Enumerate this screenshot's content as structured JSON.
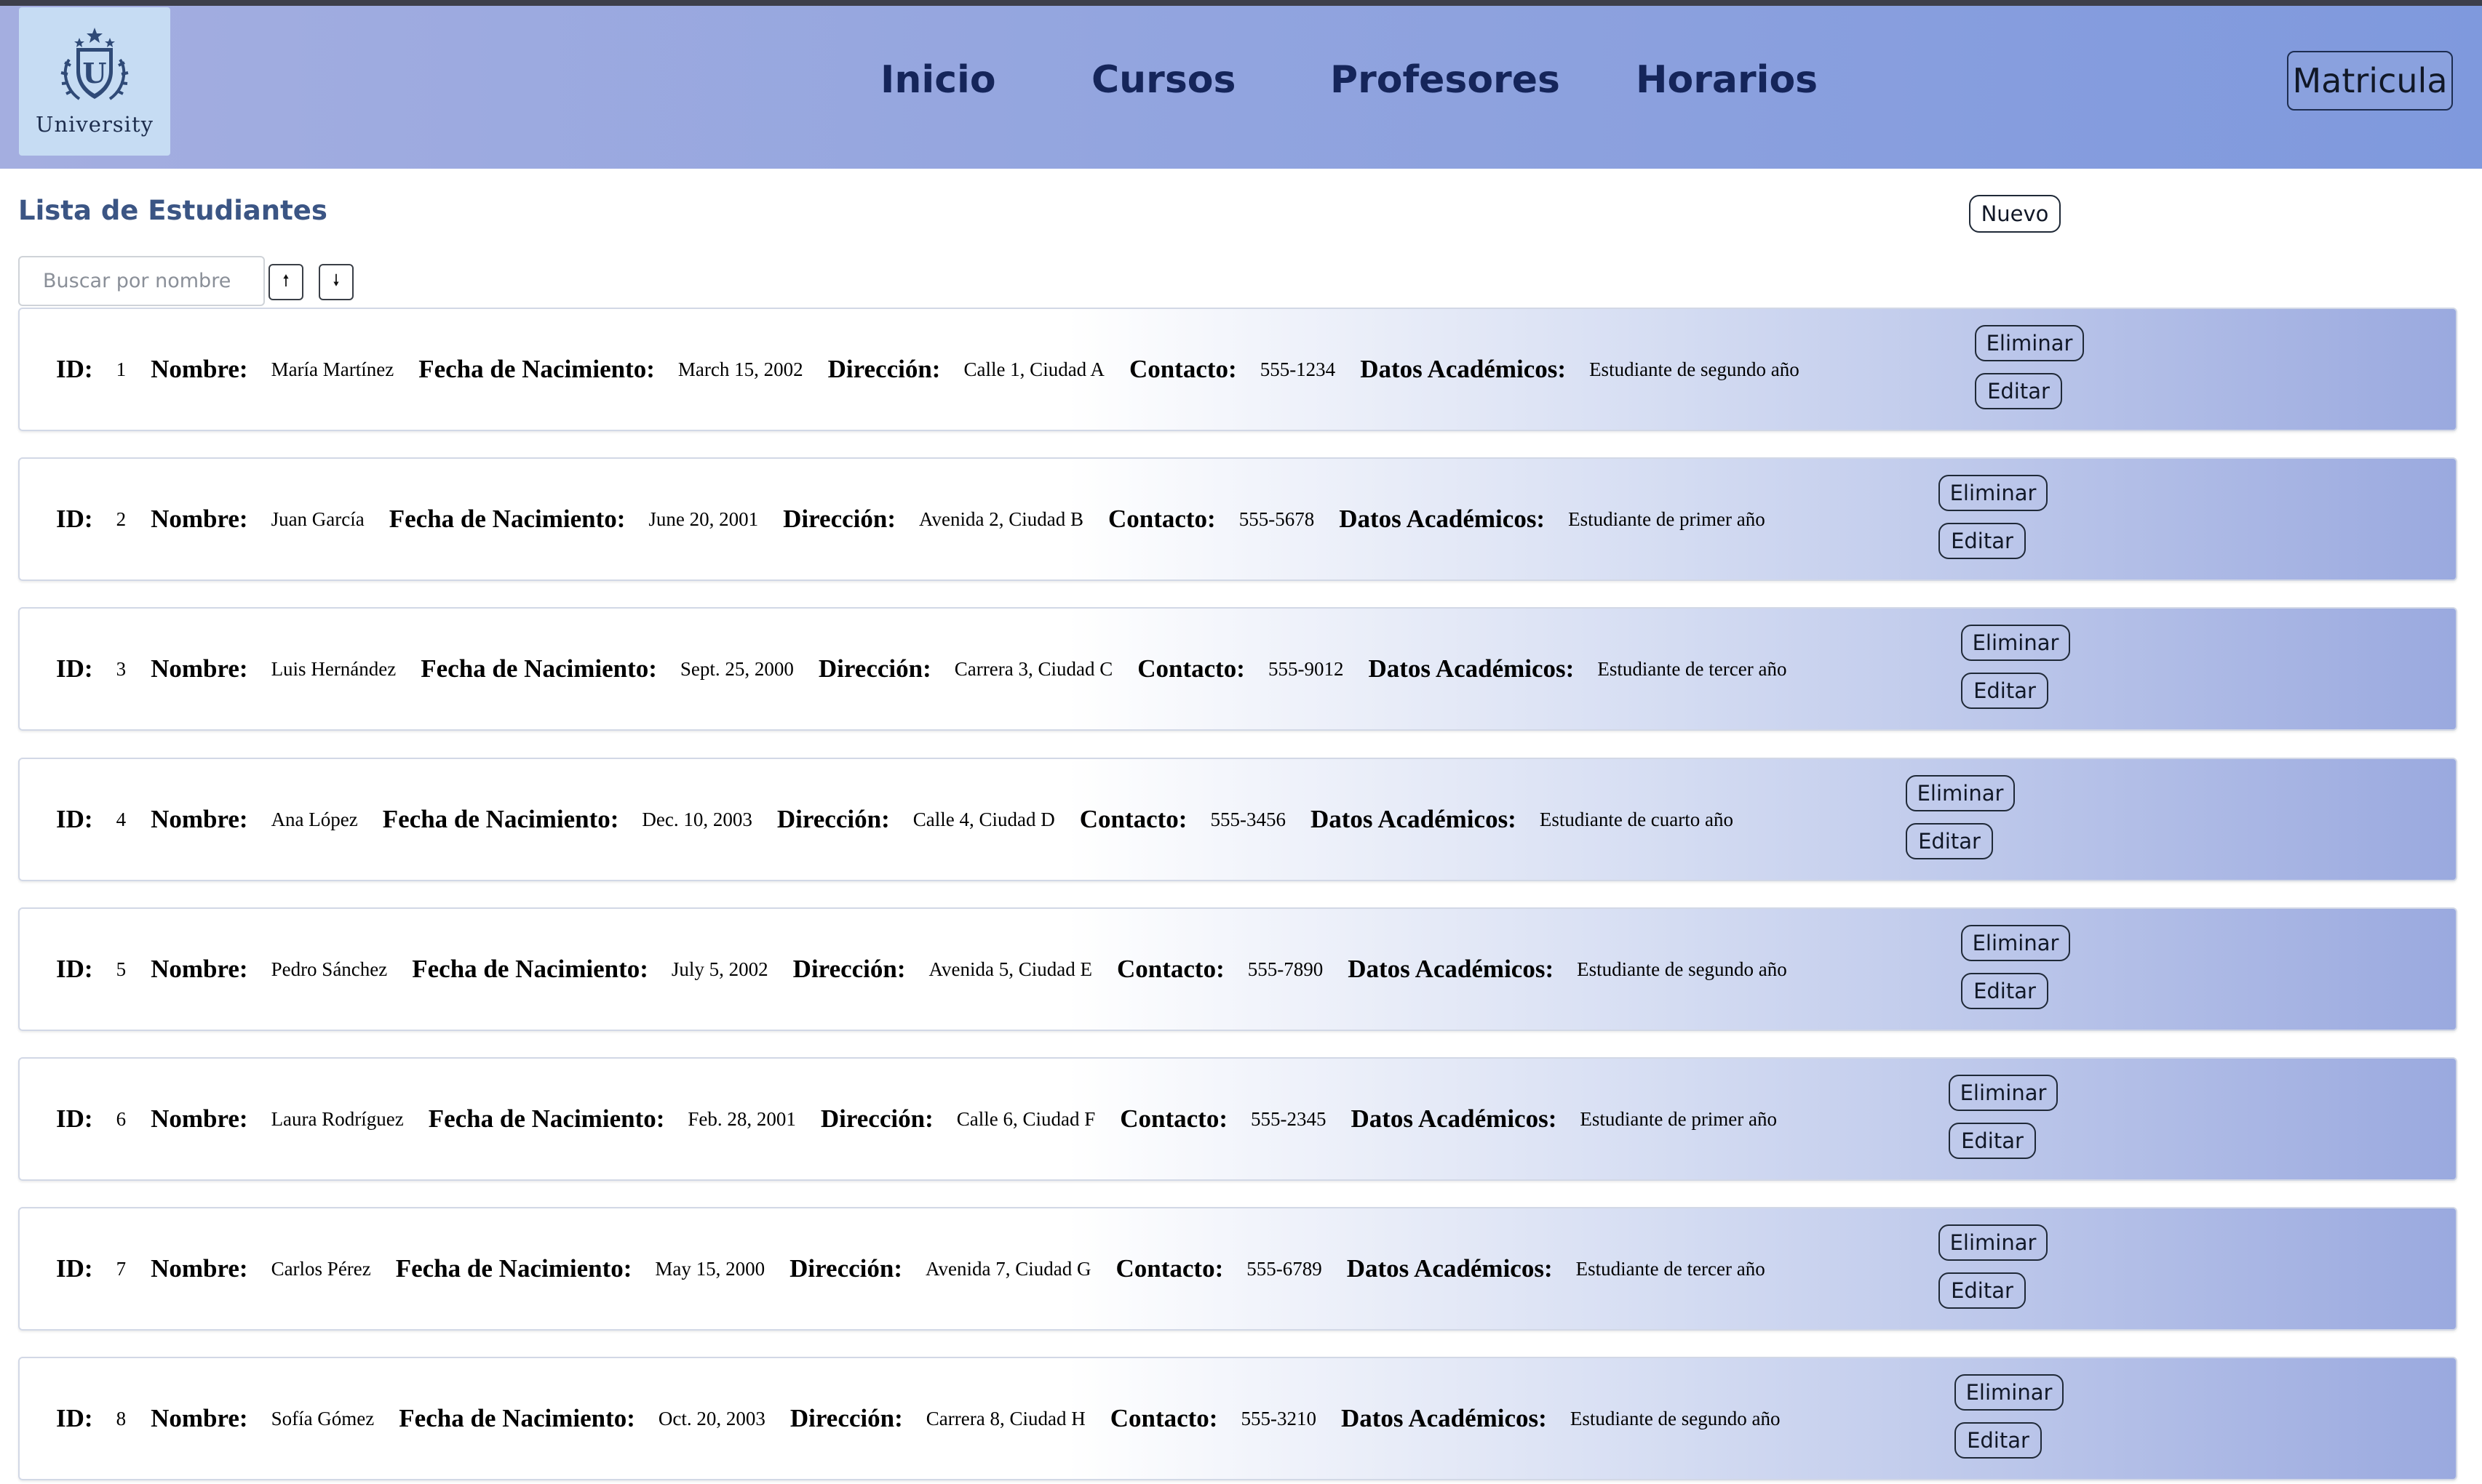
{
  "app": {
    "logo_text": "University",
    "logo_icon": "university-shield-icon"
  },
  "nav": {
    "items": [
      "Inicio",
      "Cursos",
      "Profesores",
      "Horarios"
    ],
    "matricula_label": "Matricula"
  },
  "page": {
    "title": "Lista de Estudiantes",
    "new_label": "Nuevo",
    "search_placeholder": "Buscar por nombre",
    "sort_asc_icon": "arrow-up-icon",
    "sort_desc_icon": "arrow-down-icon"
  },
  "labels": {
    "id": "ID:",
    "nombre": "Nombre:",
    "fecha": "Fecha de Nacimiento:",
    "direccion": "Dirección:",
    "contacto": "Contacto:",
    "datos": "Datos Académicos:",
    "eliminar": "Eliminar",
    "editar": "Editar"
  },
  "students": [
    {
      "id": "1",
      "nombre": "María Martínez",
      "fecha": "March 15, 2002",
      "direccion": "Calle 1, Ciudad A",
      "contacto": "555-1234",
      "datos": "Estudiante de segundo año"
    },
    {
      "id": "2",
      "nombre": "Juan García",
      "fecha": "June 20, 2001",
      "direccion": "Avenida 2, Ciudad B",
      "contacto": "555-5678",
      "datos": "Estudiante de primer año"
    },
    {
      "id": "3",
      "nombre": "Luis Hernández",
      "fecha": "Sept. 25, 2000",
      "direccion": "Carrera 3, Ciudad C",
      "contacto": "555-9012",
      "datos": "Estudiante de tercer año"
    },
    {
      "id": "4",
      "nombre": "Ana López",
      "fecha": "Dec. 10, 2003",
      "direccion": "Calle 4, Ciudad D",
      "contacto": "555-3456",
      "datos": "Estudiante de cuarto año"
    },
    {
      "id": "5",
      "nombre": "Pedro Sánchez",
      "fecha": "July 5, 2002",
      "direccion": "Avenida 5, Ciudad E",
      "contacto": "555-7890",
      "datos": "Estudiante de segundo año"
    },
    {
      "id": "6",
      "nombre": "Laura Rodríguez",
      "fecha": "Feb. 28, 2001",
      "direccion": "Calle 6, Ciudad F",
      "contacto": "555-2345",
      "datos": "Estudiante de primer año"
    },
    {
      "id": "7",
      "nombre": "Carlos Pérez",
      "fecha": "May 15, 2000",
      "direccion": "Avenida 7, Ciudad G",
      "contacto": "555-6789",
      "datos": "Estudiante de tercer año"
    },
    {
      "id": "8",
      "nombre": "Sofía Gómez",
      "fecha": "Oct. 20, 2003",
      "direccion": "Carrera 8, Ciudad H",
      "contacto": "555-3210",
      "datos": "Estudiante de segundo año"
    }
  ],
  "colors": {
    "header_start": "#a4aee0",
    "header_end": "#7f99dd",
    "nav_text": "#15255a",
    "title_text": "#3b5584",
    "card_end": "#9aa9df"
  }
}
